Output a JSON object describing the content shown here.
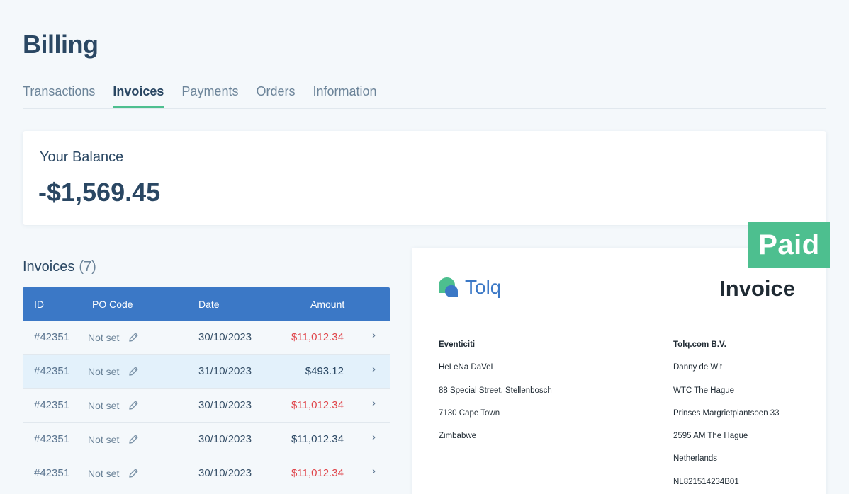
{
  "page": {
    "title": "Billing"
  },
  "tabs": [
    {
      "label": "Transactions",
      "active": false
    },
    {
      "label": "Invoices",
      "active": true
    },
    {
      "label": "Payments",
      "active": false
    },
    {
      "label": "Orders",
      "active": false
    },
    {
      "label": "Information",
      "active": false
    }
  ],
  "balance": {
    "label": "Your Balance",
    "value": "-$1,569.45"
  },
  "invoices": {
    "heading": "Invoices",
    "count": "(7)",
    "columns": [
      "ID",
      "PO Code",
      "Date",
      "Amount"
    ],
    "rows": [
      {
        "id": "#42351",
        "po": "Not set",
        "date": "30/10/2023",
        "amount": "$11,012.34",
        "status": "red",
        "selected": false
      },
      {
        "id": "#42351",
        "po": "Not set",
        "date": "31/10/2023",
        "amount": "$493.12",
        "status": "dark",
        "selected": true
      },
      {
        "id": "#42351",
        "po": "Not set",
        "date": "30/10/2023",
        "amount": "$11,012.34",
        "status": "red",
        "selected": false
      },
      {
        "id": "#42351",
        "po": "Not set",
        "date": "30/10/2023",
        "amount": "$11,012.34",
        "status": "dark",
        "selected": false
      },
      {
        "id": "#42351",
        "po": "Not set",
        "date": "30/10/2023",
        "amount": "$11,012.34",
        "status": "red",
        "selected": false
      }
    ]
  },
  "preview": {
    "badge": "Paid",
    "logo_text": "Tolq",
    "title": "Invoice",
    "from": [
      "Eventiciti",
      "HeLeNa DaVeL",
      "88 Special Street, Stellenbosch",
      "7130 Cape Town",
      "Zimbabwe"
    ],
    "to": [
      "Tolq.com B.V.",
      "Danny de Wit",
      "WTC The Hague",
      "Prinses Margrietplantsoen 33",
      "2595 AM The Hague",
      "Netherlands",
      "NL821514234B01"
    ]
  },
  "colors": {
    "accent_green": "#4dbf8f",
    "header_blue": "#3b78c6",
    "amount_red": "#e0454b",
    "text_dark": "#2a4763"
  }
}
